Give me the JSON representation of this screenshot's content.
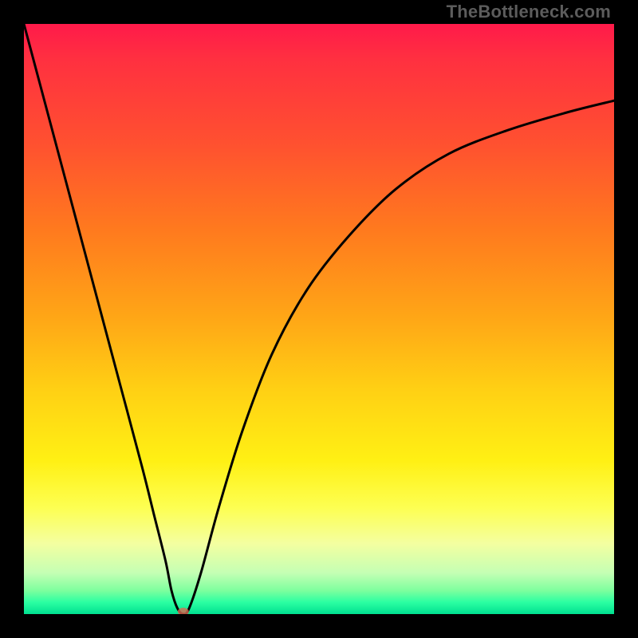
{
  "watermark": "TheBottleneck.com",
  "chart_data": {
    "type": "line",
    "title": "",
    "xlabel": "",
    "ylabel": "",
    "xlim": [
      0,
      100
    ],
    "ylim": [
      0,
      100
    ],
    "series": [
      {
        "name": "curve",
        "x": [
          0,
          4,
          8,
          12,
          16,
          20,
          22,
          24,
          25,
          26,
          27,
          28,
          30,
          33,
          37,
          42,
          48,
          55,
          63,
          72,
          82,
          92,
          100
        ],
        "values": [
          100,
          85,
          70,
          55,
          40,
          25,
          17,
          9,
          4,
          1,
          0,
          1,
          7,
          18,
          31,
          44,
          55,
          64,
          72,
          78,
          82,
          85,
          87
        ]
      }
    ],
    "marker": {
      "x": 27,
      "y": 0,
      "color": "#d96a52"
    },
    "background_gradient": {
      "orientation": "vertical",
      "stops": [
        {
          "pos": 0.0,
          "color": "#ff1a4a"
        },
        {
          "pos": 0.5,
          "color": "#ffa716"
        },
        {
          "pos": 0.8,
          "color": "#fff014"
        },
        {
          "pos": 1.0,
          "color": "#00e090"
        }
      ]
    }
  }
}
